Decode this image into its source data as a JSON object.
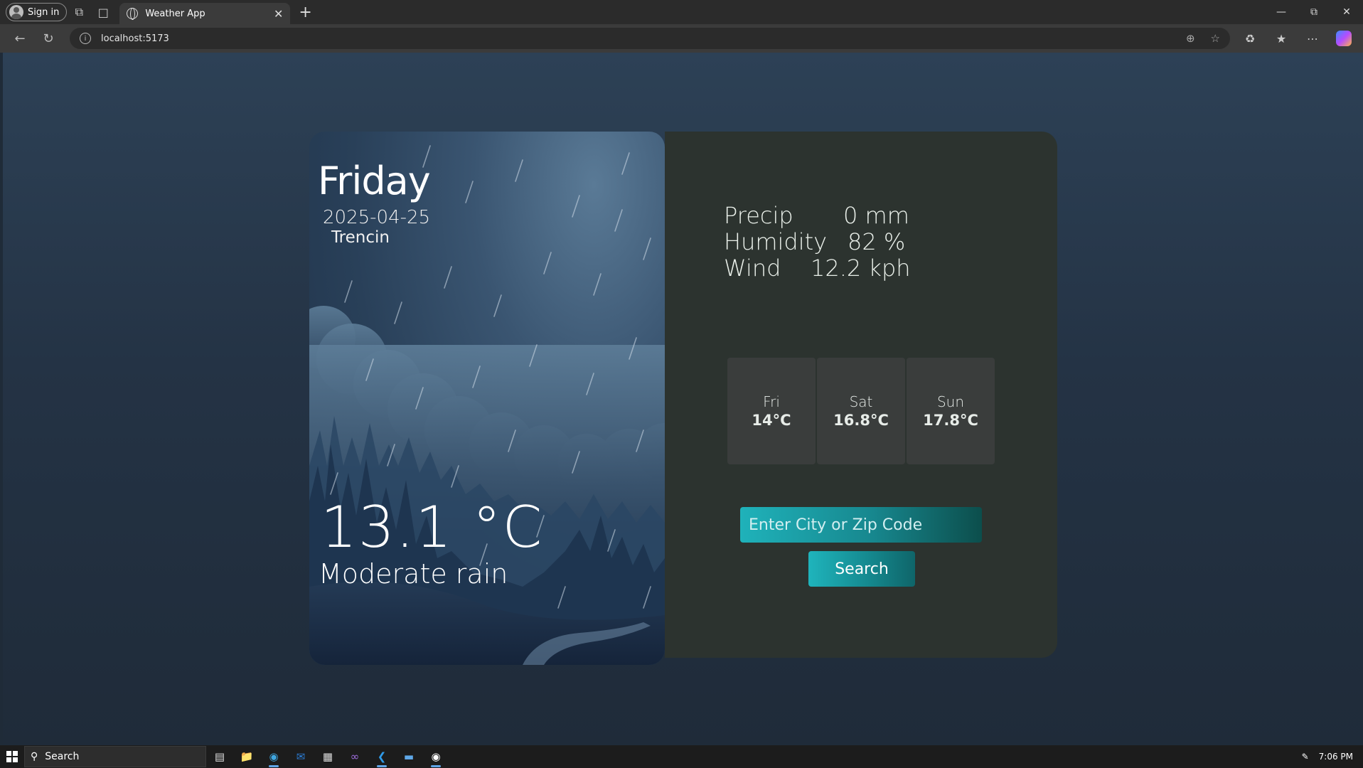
{
  "browser": {
    "profile_label": "Sign in",
    "tab_title": "Weather App",
    "url": "localhost:5173"
  },
  "weather": {
    "day": "Friday",
    "date": "2025-04-25",
    "city": "Trencin",
    "temperature": "13.1 °C",
    "condition": "Moderate rain"
  },
  "stats": [
    {
      "label": "Precip",
      "value": "0 mm"
    },
    {
      "label": "Humidity",
      "value": "82 %"
    },
    {
      "label": "Wind",
      "value": "12.2 kph"
    }
  ],
  "forecast": [
    {
      "day": "Fri",
      "temp": "14°C"
    },
    {
      "day": "Sat",
      "temp": "16.8°C"
    },
    {
      "day": "Sun",
      "temp": "17.8°C"
    }
  ],
  "search": {
    "placeholder": "Enter City or Zip Code",
    "button_label": "Search"
  },
  "taskbar": {
    "search_label": "Search",
    "time": "7:06 PM"
  },
  "colors": {
    "page_bg": "#243345",
    "right_panel": "#2c332f",
    "accent": "#1fb2ba"
  }
}
